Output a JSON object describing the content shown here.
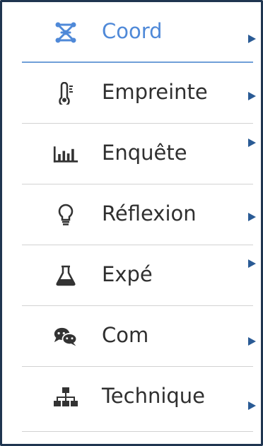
{
  "menu": {
    "items": [
      {
        "label": "Coord",
        "icon": "molecule-icon",
        "active": true
      },
      {
        "label": "Empreinte",
        "icon": "thermometer-icon",
        "active": false
      },
      {
        "label": "Enquête",
        "icon": "bar-chart-icon",
        "active": false
      },
      {
        "label": "Réflexion",
        "icon": "lightbulb-icon",
        "active": false
      },
      {
        "label": "Expé",
        "icon": "flask-icon",
        "active": false
      },
      {
        "label": "Com",
        "icon": "chat-bubbles-icon",
        "active": false
      },
      {
        "label": "Technique",
        "icon": "sitemap-icon",
        "active": false
      }
    ]
  },
  "colors": {
    "border": "#1f3550",
    "active_text": "#4f89d8",
    "active_icon": "#4f89d8",
    "text": "#2f2f2f",
    "icon": "#333333",
    "arrow": "#2a5b95",
    "separator": "#d2d2d2",
    "active_separator": "#6f9fd8"
  }
}
